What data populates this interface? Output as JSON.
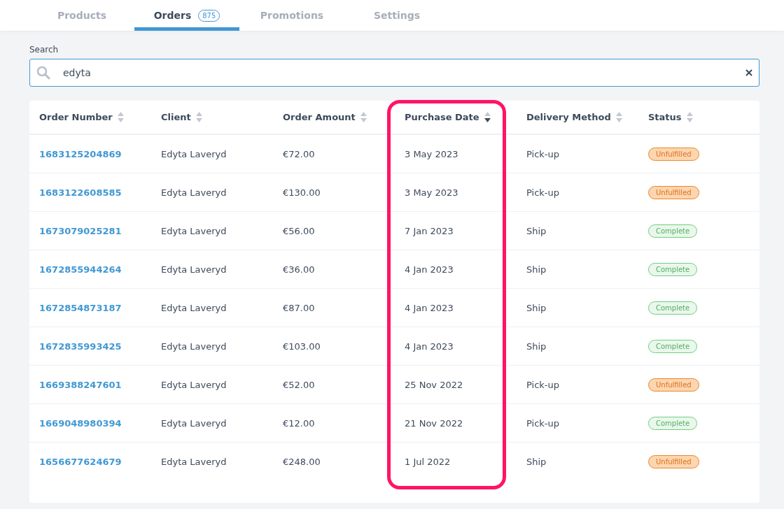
{
  "tabs": [
    {
      "label": "Products",
      "selected": false
    },
    {
      "label": "Orders",
      "selected": true,
      "count": "875"
    },
    {
      "label": "Promotions",
      "selected": false
    },
    {
      "label": "Settings",
      "selected": false
    }
  ],
  "search": {
    "label": "Search",
    "value": "edyta"
  },
  "table": {
    "columns": [
      {
        "label": "Order Number",
        "sorted": false,
        "highlighted": false
      },
      {
        "label": "Client",
        "sorted": false,
        "highlighted": false
      },
      {
        "label": "Order Amount",
        "sorted": false,
        "highlighted": false
      },
      {
        "label": "Purchase Date",
        "sorted": true,
        "highlighted": true
      },
      {
        "label": "Delivery Method",
        "sorted": false,
        "highlighted": false
      },
      {
        "label": "Status",
        "sorted": false,
        "highlighted": false
      }
    ],
    "rows": [
      {
        "order": "1683125204869",
        "client": "Edyta Laveryd",
        "amount": "€72.00",
        "date": "3 May 2023",
        "delivery": "Pick-up",
        "status": {
          "label": "Unfulfilled",
          "kind": "unfulfilled"
        }
      },
      {
        "order": "1683122608585",
        "client": "Edyta Laveryd",
        "amount": "€130.00",
        "date": "3 May 2023",
        "delivery": "Pick-up",
        "status": {
          "label": "Unfulfilled",
          "kind": "unfulfilled"
        }
      },
      {
        "order": "1673079025281",
        "client": "Edyta Laveryd",
        "amount": "€56.00",
        "date": "7 Jan 2023",
        "delivery": "Ship",
        "status": {
          "label": "Complete",
          "kind": "complete"
        }
      },
      {
        "order": "1672855944264",
        "client": "Edyta Laveryd",
        "amount": "€36.00",
        "date": "4 Jan 2023",
        "delivery": "Ship",
        "status": {
          "label": "Complete",
          "kind": "complete"
        }
      },
      {
        "order": "1672854873187",
        "client": "Edyta Laveryd",
        "amount": "€87.00",
        "date": "4 Jan 2023",
        "delivery": "Ship",
        "status": {
          "label": "Complete",
          "kind": "complete"
        }
      },
      {
        "order": "1672835993425",
        "client": "Edyta Laveryd",
        "amount": "€103.00",
        "date": "4 Jan 2023",
        "delivery": "Ship",
        "status": {
          "label": "Complete",
          "kind": "complete"
        }
      },
      {
        "order": "1669388247601",
        "client": "Edyta Laveryd",
        "amount": "€52.00",
        "date": "25 Nov 2022",
        "delivery": "Pick-up",
        "status": {
          "label": "Unfulfilled",
          "kind": "unfulfilled"
        }
      },
      {
        "order": "1669048980394",
        "client": "Edyta Laveryd",
        "amount": "€12.00",
        "date": "21 Nov 2022",
        "delivery": "Pick-up",
        "status": {
          "label": "Complete",
          "kind": "complete"
        }
      },
      {
        "order": "1656677624679",
        "client": "Edyta Laveryd",
        "amount": "€248.00",
        "date": "1 Jul 2022",
        "delivery": "Ship",
        "status": {
          "label": "Unfulfilled",
          "kind": "unfulfilled"
        }
      }
    ]
  }
}
